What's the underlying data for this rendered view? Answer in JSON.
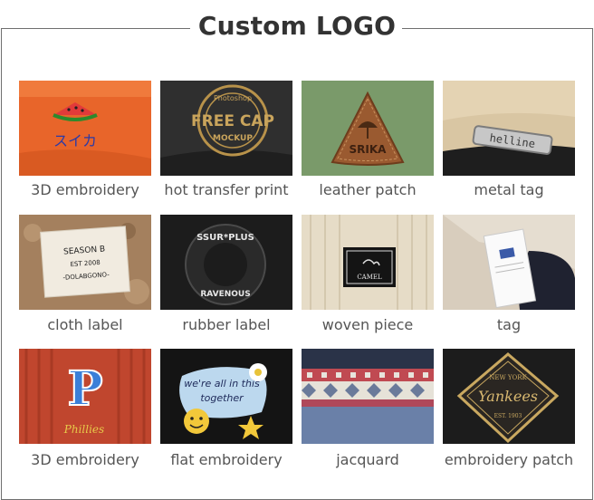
{
  "title": "Custom LOGO",
  "items": [
    {
      "label": "3D embroidery",
      "logo_text": "スイカ"
    },
    {
      "label": "hot transfer print",
      "logo_text": "FREE CAP",
      "logo_subtext": "MOCKUP",
      "logo_arc": "Photoshop"
    },
    {
      "label": "leather patch",
      "logo_text": "SRIKA"
    },
    {
      "label": "metal tag",
      "logo_text": "helline"
    },
    {
      "label": "cloth label",
      "logo_text": "SEASON B",
      "logo_subtext": "EST 2008",
      "logo_extra": "-DOLABGONO-"
    },
    {
      "label": "rubber label",
      "logo_text": "SSUR*PLUS",
      "logo_subtext": "RAVENOUS"
    },
    {
      "label": "woven piece",
      "logo_text": "CAMEL"
    },
    {
      "label": "tag",
      "logo_text": ""
    },
    {
      "label": "3D embroidery",
      "logo_text": "P",
      "logo_subtext": "Phillies"
    },
    {
      "label": "flat embroidery",
      "logo_text": "we're all in this",
      "logo_subtext": "together"
    },
    {
      "label": "jacquard",
      "logo_text": ""
    },
    {
      "label": "embroidery patch",
      "logo_text": "Yankees",
      "logo_subtext": "NEW YORK",
      "logo_extra": "EST. 1903"
    }
  ]
}
